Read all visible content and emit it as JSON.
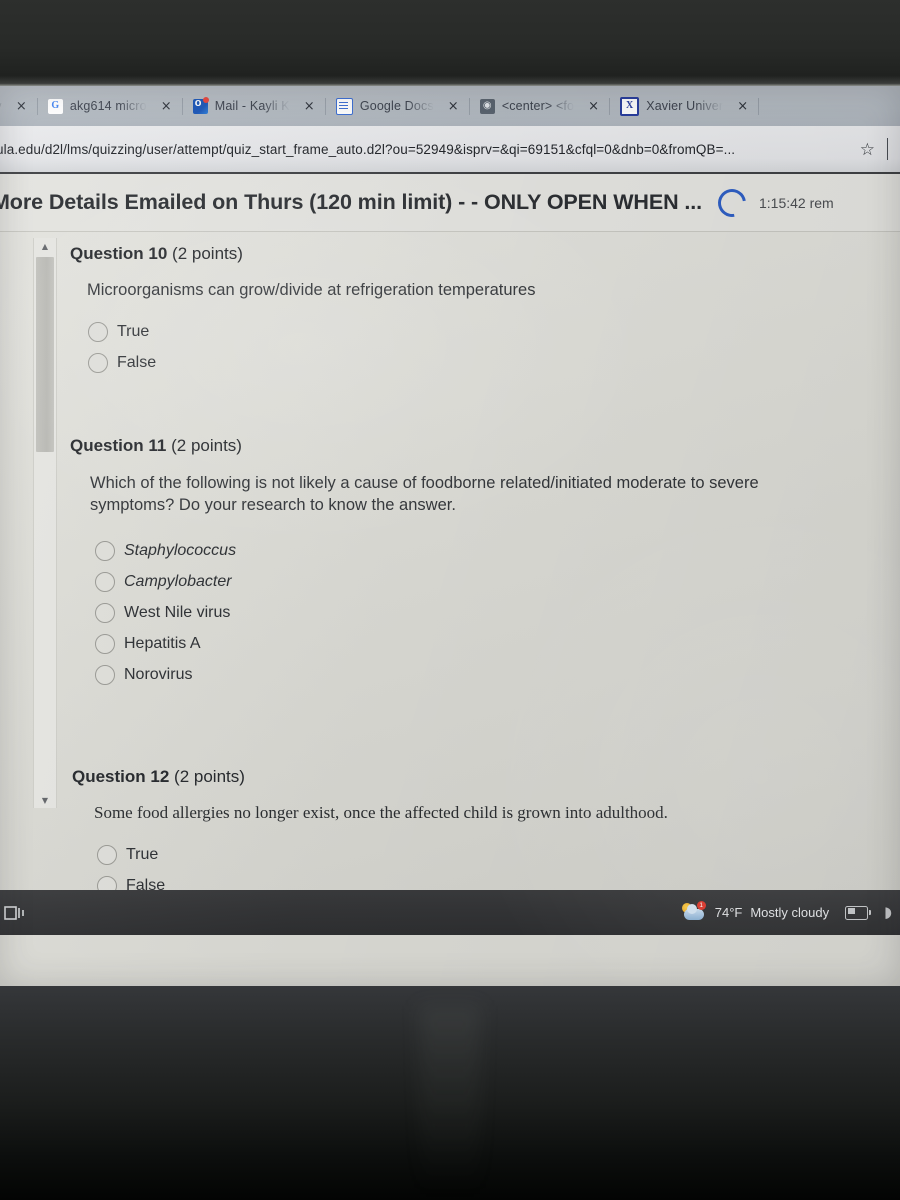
{
  "browser": {
    "tabs": [
      {
        "label": "ory",
        "favicon": "none-icon",
        "truncated": true
      },
      {
        "label": "akg614 micro",
        "favicon": "google-icon"
      },
      {
        "label": "Mail - Kayli  K",
        "favicon": "outlook-icon"
      },
      {
        "label": "Google Docs",
        "favicon": "google-docs-icon"
      },
      {
        "label": "<center> <fo",
        "favicon": "globe-icon"
      },
      {
        "label": "Xavier Univer",
        "favicon": "xavier-icon"
      }
    ],
    "close_label": "×",
    "url": "ula.edu/d2l/lms/quizzing/user/attempt/quiz_start_frame_auto.d2l?ou=52949&isprv=&qi=69151&cfql=0&dnb=0&fromQB=...",
    "bookmark_icon": "☆"
  },
  "quiz_header": {
    "title": "More Details Emailed on Thurs (120 min limit) - - ONLY OPEN WHEN ...",
    "timer": "1:15:42 rem",
    "spinner_color": "#2f5fc4"
  },
  "scrollbar": {
    "up_arrow": "▲",
    "down_arrow": "▼"
  },
  "questions": [
    {
      "number": "Question 10",
      "points": "(2 points)",
      "text": "Microorganisms can grow/divide at refrigeration temperatures",
      "font": "sans",
      "options": [
        {
          "label": "True",
          "style": "normal",
          "selected": false
        },
        {
          "label": "False",
          "style": "normal",
          "selected": false
        }
      ]
    },
    {
      "number": "Question 11",
      "points": "(2 points)",
      "text": "Which of the following is not likely a cause of foodborne related/initiated moderate to severe symptoms? Do your research to know the answer.",
      "font": "sans",
      "options": [
        {
          "label": "Staphylococcus",
          "style": "italic",
          "selected": false
        },
        {
          "label": "Campylobacter",
          "style": "italic",
          "selected": false
        },
        {
          "label": "West Nile virus",
          "style": "normal",
          "selected": false
        },
        {
          "label": "Hepatitis A",
          "style": "normal",
          "selected": false
        },
        {
          "label": "Norovirus",
          "style": "normal",
          "selected": false
        }
      ]
    },
    {
      "number": "Question 12",
      "points": "(2 points)",
      "text": "Some food allergies no longer exist, once the affected child is grown into adulthood.",
      "font": "serif",
      "options": [
        {
          "label": "True",
          "style": "normal",
          "selected": false
        },
        {
          "label": "False",
          "style": "normal",
          "selected": false
        }
      ]
    }
  ],
  "taskbar": {
    "start_icon": "task-view-icon",
    "weather_temp": "74°F",
    "weather_desc": "Mostly cloudy",
    "weather_badge": "1",
    "battery_icon": "battery-icon",
    "wifi_icon": "wifi-icon"
  }
}
